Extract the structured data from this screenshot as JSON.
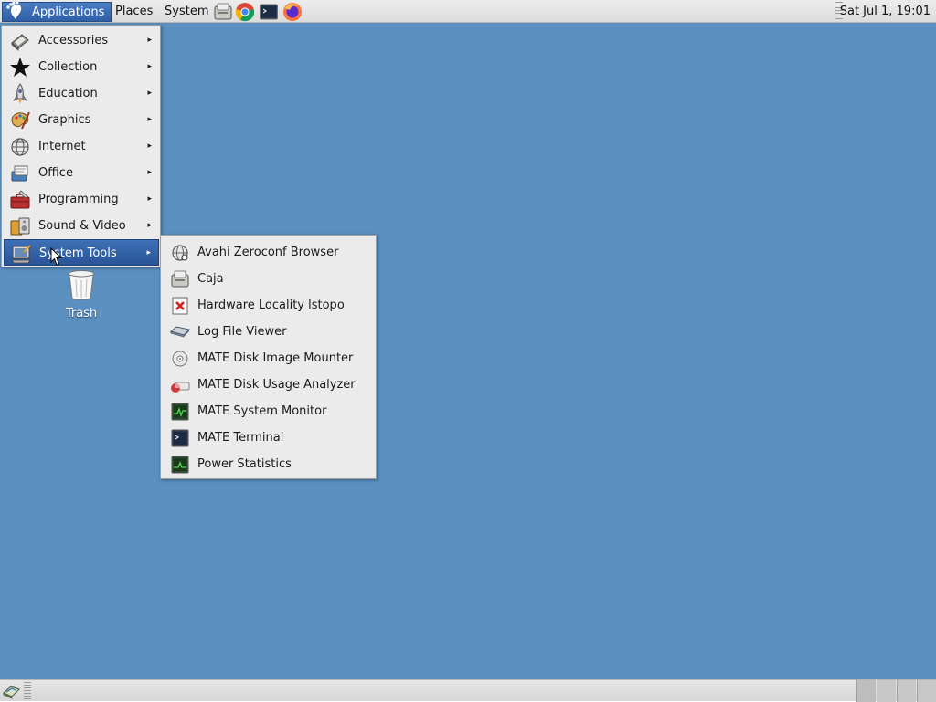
{
  "top_panel": {
    "menus": [
      "Applications",
      "Places",
      "System"
    ],
    "clock": "Sat Jul  1, 19:01",
    "launchers": [
      "file-manager-icon",
      "chrome-icon",
      "terminal-icon",
      "firefox-icon"
    ]
  },
  "main_menu": {
    "items": [
      {
        "label": "Accessories",
        "icon": "accessories-icon"
      },
      {
        "label": "Collection",
        "icon": "star-icon"
      },
      {
        "label": "Education",
        "icon": "rocket-icon"
      },
      {
        "label": "Graphics",
        "icon": "palette-icon"
      },
      {
        "label": "Internet",
        "icon": "globe-icon"
      },
      {
        "label": "Office",
        "icon": "office-icon"
      },
      {
        "label": "Programming",
        "icon": "toolbox-icon"
      },
      {
        "label": "Sound & Video",
        "icon": "multimedia-icon"
      },
      {
        "label": "System Tools",
        "icon": "system-tools-icon"
      }
    ],
    "selected": "System Tools"
  },
  "system_tools_submenu": {
    "items": [
      {
        "label": "Avahi Zeroconf Browser",
        "icon": "network-browser-icon"
      },
      {
        "label": "Caja",
        "icon": "file-manager-icon"
      },
      {
        "label": "Hardware Locality lstopo",
        "icon": "hwloc-icon"
      },
      {
        "label": "Log File Viewer",
        "icon": "log-viewer-icon"
      },
      {
        "label": "MATE Disk Image Mounter",
        "icon": "disc-icon"
      },
      {
        "label": "MATE Disk Usage Analyzer",
        "icon": "disk-usage-icon"
      },
      {
        "label": "MATE System Monitor",
        "icon": "system-monitor-icon"
      },
      {
        "label": "MATE Terminal",
        "icon": "terminal-icon"
      },
      {
        "label": "Power Statistics",
        "icon": "power-statistics-icon"
      }
    ]
  },
  "desktop": {
    "trash_label": "Trash"
  },
  "colors": {
    "desktop_background": "#5a8fc0",
    "selection": "#3464a8",
    "panel": "#e0e0e0",
    "menu_background": "#ebebeb"
  }
}
